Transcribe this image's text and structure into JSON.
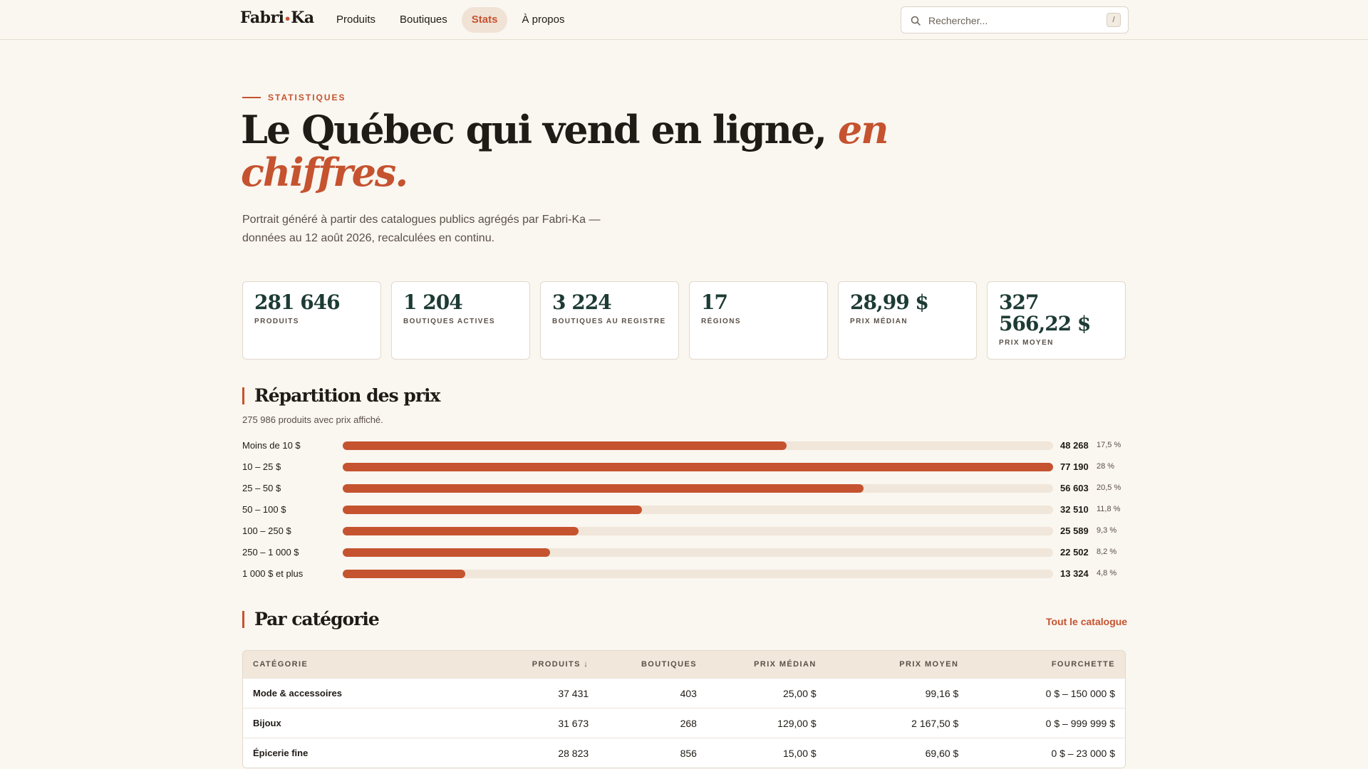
{
  "header": {
    "logo_left": "Fabri",
    "logo_dot": "•",
    "logo_right": "Ka",
    "nav": [
      "Produits",
      "Boutiques",
      "Stats",
      "À propos"
    ],
    "active_nav": "Stats",
    "search_placeholder": "Rechercher...",
    "search_shortcut": "/"
  },
  "hero": {
    "eyebrow": "STATISTIQUES",
    "title_main": "Le Québec qui vend en ligne, ",
    "title_accent": "en chiffres.",
    "lede": "Portrait généré à partir des catalogues publics agrégés par Fabri-Ka — données au 12 août 2026, recalculées en continu."
  },
  "stats": [
    {
      "value": "281 646",
      "label": "PRODUITS"
    },
    {
      "value": "1 204",
      "label": "BOUTIQUES ACTIVES"
    },
    {
      "value": "3 224",
      "label": "BOUTIQUES AU REGISTRE"
    },
    {
      "value": "17",
      "label": "RÉGIONS"
    },
    {
      "value": "28,99 $",
      "label": "PRIX MÉDIAN"
    },
    {
      "value": "327 566,22 $",
      "label": "PRIX MOYEN"
    }
  ],
  "distribution": {
    "title": "Répartition des prix",
    "subtitle": "275 986 produits avec prix affiché.",
    "rows": [
      {
        "label": "Moins de 10 $",
        "count": "48 268",
        "pct": "17,5 %",
        "value": 48268
      },
      {
        "label": "10 – 25 $",
        "count": "77 190",
        "pct": "28 %",
        "value": 77190
      },
      {
        "label": "25 – 50 $",
        "count": "56 603",
        "pct": "20,5 %",
        "value": 56603
      },
      {
        "label": "50 – 100 $",
        "count": "32 510",
        "pct": "11,8 %",
        "value": 32510
      },
      {
        "label": "100 – 250 $",
        "count": "25 589",
        "pct": "9,3 %",
        "value": 25589
      },
      {
        "label": "250 – 1 000 $",
        "count": "22 502",
        "pct": "8,2 %",
        "value": 22502
      },
      {
        "label": "1 000 $ et plus",
        "count": "13 324",
        "pct": "4,8 %",
        "value": 13324
      }
    ]
  },
  "categories": {
    "title": "Par catégorie",
    "see_all": "Tout le catalogue",
    "headers": [
      "CATÉGORIE",
      "PRODUITS ↓",
      "BOUTIQUES",
      "PRIX MÉDIAN",
      "PRIX MOYEN",
      "FOURCHETTE"
    ],
    "rows": [
      [
        "Mode & accessoires",
        "37 431",
        "403",
        "25,00 $",
        "99,16 $",
        "0 $ – 150 000 $"
      ],
      [
        "Bijoux",
        "31 673",
        "268",
        "129,00 $",
        "2 167,50 $",
        "0 $ – 999 999 $"
      ],
      [
        "Épicerie fine",
        "28 823",
        "856",
        "15,00 $",
        "69,60 $",
        "0 $ – 23 000 $"
      ]
    ]
  },
  "colors": {
    "accent": "#c5532f",
    "dark_green": "#1d3b34",
    "background": "#faf6f0"
  }
}
